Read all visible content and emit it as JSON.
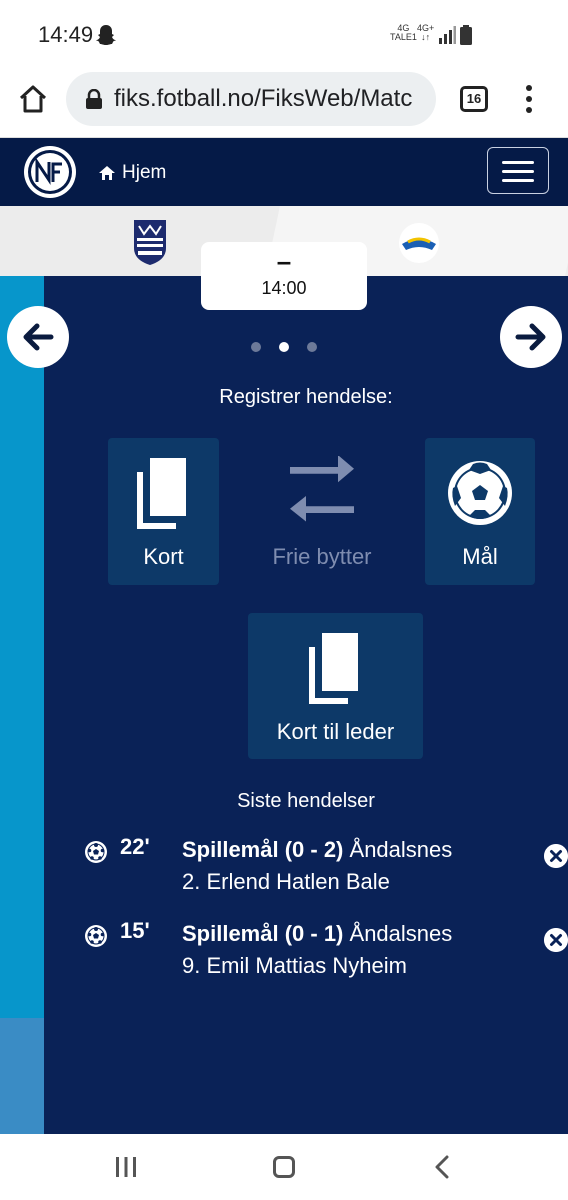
{
  "status_bar": {
    "time": "14:49",
    "network_left_top": "4G",
    "network_left_bottom": "TALE1",
    "network_right_top": "4G+",
    "network_right_bottom": "↓↑"
  },
  "browser": {
    "url": "fiks.fotball.no/FiksWeb/Matc",
    "tab_count": "16"
  },
  "header": {
    "home_label": "Hjem"
  },
  "match": {
    "score": "–",
    "kickoff": "14:00"
  },
  "register": {
    "title": "Registrer hendelse:",
    "card_label": "Kort",
    "free_subs_label": "Frie bytter",
    "goal_label": "Mål",
    "leader_card_label": "Kort til leder"
  },
  "recent": {
    "title": "Siste hendelser",
    "events": [
      {
        "minute": "22'",
        "type": "Spillemål (0 - 2)",
        "team": "Åndalsnes",
        "player": "2. Erlend Hatlen Bale"
      },
      {
        "minute": "15'",
        "type": "Spillemål (0 - 1)",
        "team": "Åndalsnes",
        "player": "9. Emil Mattias Nyheim"
      }
    ]
  },
  "colors": {
    "header_bg": "#051a47",
    "main_bg": "#0a2257",
    "tile_bg": "#0d3968",
    "accent_strip": "#0796cb"
  }
}
